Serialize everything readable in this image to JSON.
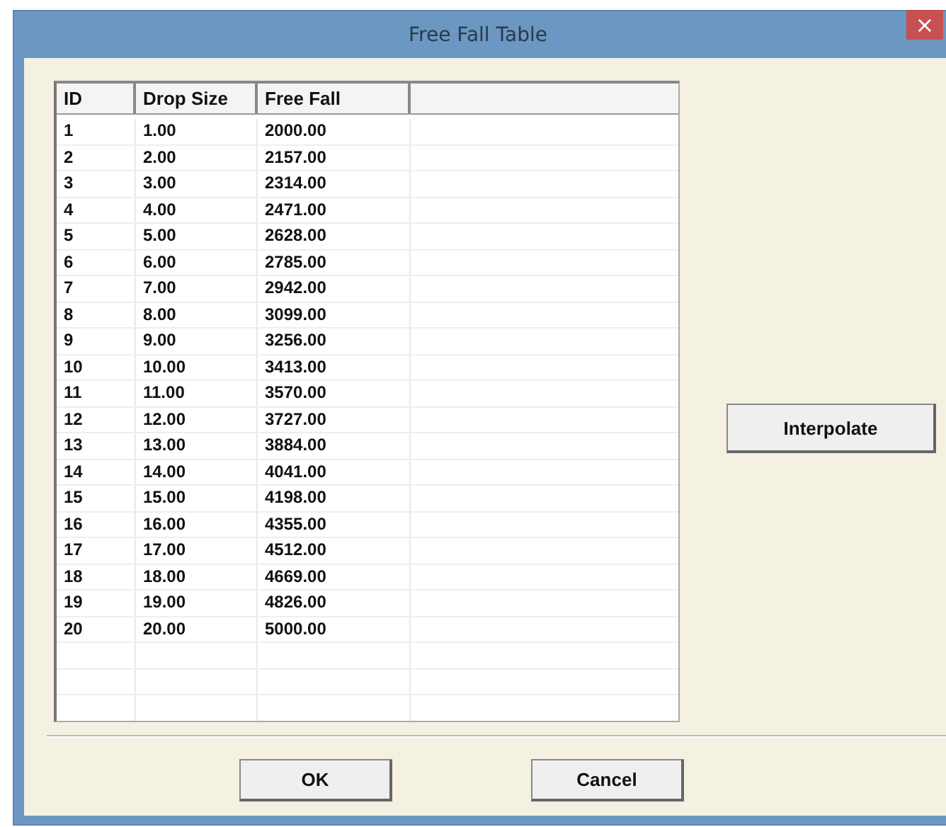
{
  "window": {
    "title": "Free Fall Table",
    "close": "×"
  },
  "table": {
    "columns": [
      "ID",
      "Drop Size",
      "Free Fall"
    ],
    "rows": [
      [
        "1",
        "1.00",
        "2000.00"
      ],
      [
        "2",
        "2.00",
        "2157.00"
      ],
      [
        "3",
        "3.00",
        "2314.00"
      ],
      [
        "4",
        "4.00",
        "2471.00"
      ],
      [
        "5",
        "5.00",
        "2628.00"
      ],
      [
        "6",
        "6.00",
        "2785.00"
      ],
      [
        "7",
        "7.00",
        "2942.00"
      ],
      [
        "8",
        "8.00",
        "3099.00"
      ],
      [
        "9",
        "9.00",
        "3256.00"
      ],
      [
        "10",
        "10.00",
        "3413.00"
      ],
      [
        "11",
        "11.00",
        "3570.00"
      ],
      [
        "12",
        "12.00",
        "3727.00"
      ],
      [
        "13",
        "13.00",
        "3884.00"
      ],
      [
        "14",
        "14.00",
        "4041.00"
      ],
      [
        "15",
        "15.00",
        "4198.00"
      ],
      [
        "16",
        "16.00",
        "4355.00"
      ],
      [
        "17",
        "17.00",
        "4512.00"
      ],
      [
        "18",
        "18.00",
        "4669.00"
      ],
      [
        "19",
        "19.00",
        "4826.00"
      ],
      [
        "20",
        "20.00",
        "5000.00"
      ]
    ]
  },
  "side_button": "Interpolate",
  "buttons": [
    "OK",
    "Cancel"
  ]
}
